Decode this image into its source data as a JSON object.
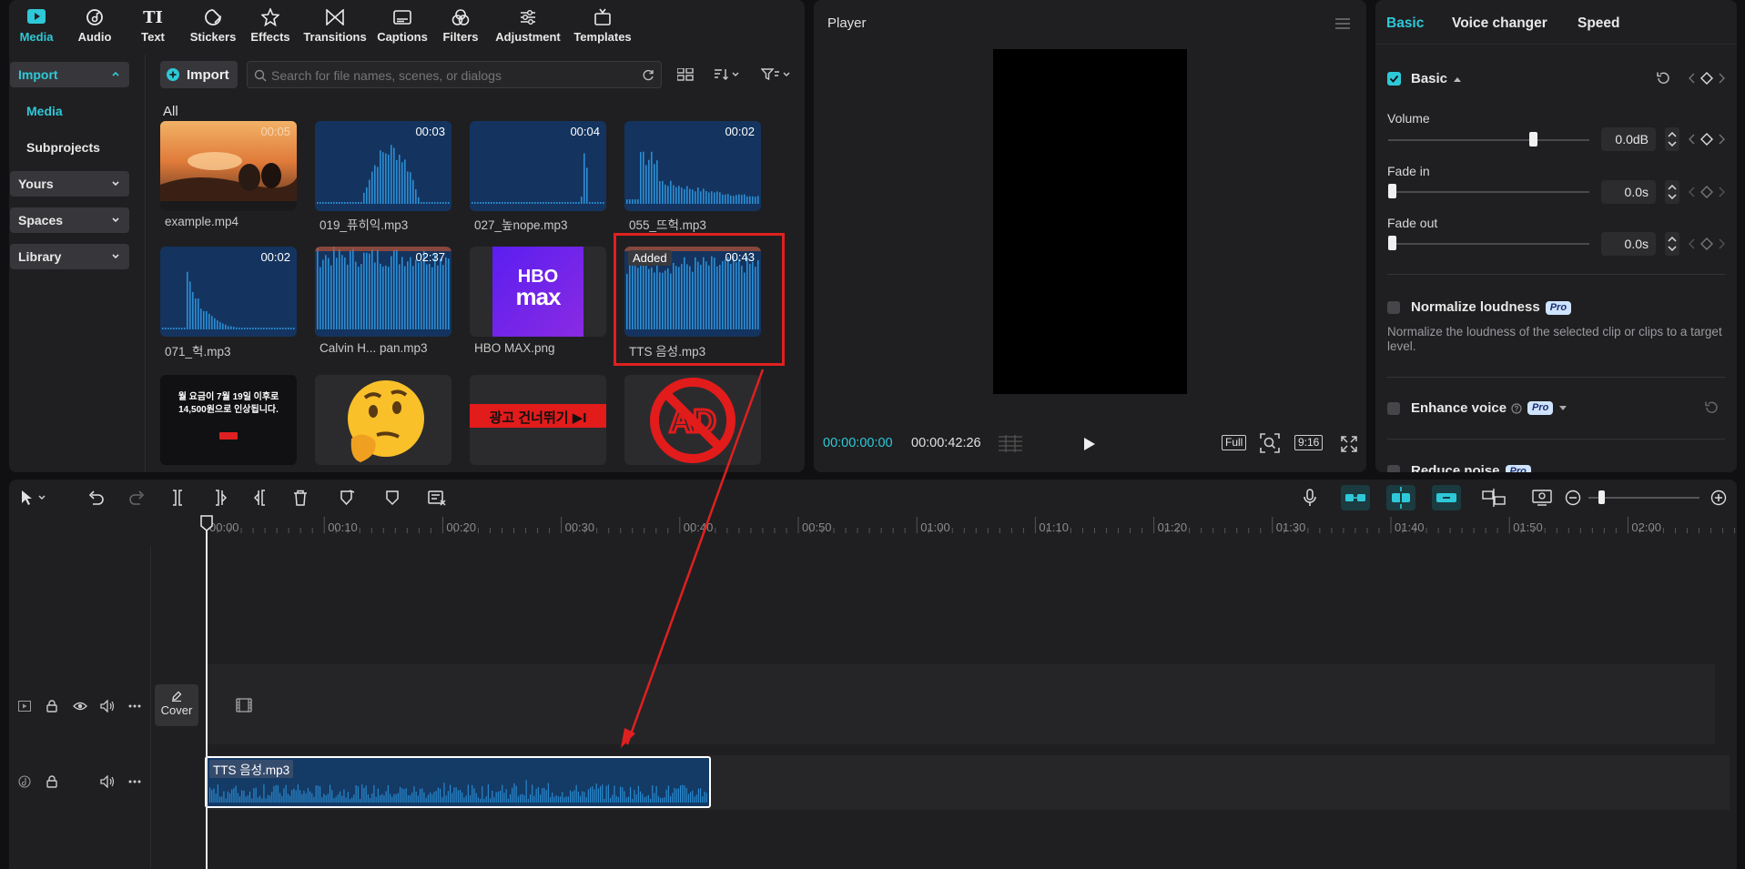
{
  "top_tabs": [
    {
      "label": "Media",
      "icon": "media-icon",
      "active": true
    },
    {
      "label": "Audio",
      "icon": "audio-icon"
    },
    {
      "label": "Text",
      "icon": "text-icon"
    },
    {
      "label": "Stickers",
      "icon": "stickers-icon"
    },
    {
      "label": "Effects",
      "icon": "effects-icon"
    },
    {
      "label": "Transitions",
      "icon": "transitions-icon"
    },
    {
      "label": "Captions",
      "icon": "captions-icon"
    },
    {
      "label": "Filters",
      "icon": "filters-icon"
    },
    {
      "label": "Adjustment",
      "icon": "adjustment-icon"
    },
    {
      "label": "Templates",
      "icon": "templates-icon"
    }
  ],
  "left_nav": {
    "import": "Import",
    "media": "Media",
    "subprojects": "Subprojects",
    "yours": "Yours",
    "spaces": "Spaces",
    "library": "Library"
  },
  "media_toolbar": {
    "import_button": "Import",
    "search_placeholder": "Search for file names, scenes, or dialogs",
    "filter_label": "All"
  },
  "media_items": [
    {
      "name": "example.mp4",
      "duration": "00:05",
      "kind": "video"
    },
    {
      "name": "019_퓨히익.mp3",
      "duration": "00:03",
      "kind": "audio"
    },
    {
      "name": "027_높nope.mp3",
      "duration": "00:04",
      "kind": "audio"
    },
    {
      "name": "055_뜨헉.mp3",
      "duration": "00:02",
      "kind": "audio"
    },
    {
      "name": "071_헉.mp3",
      "duration": "00:02",
      "kind": "audio"
    },
    {
      "name": "Calvin H... pan.mp3",
      "duration": "02:37",
      "kind": "audio"
    },
    {
      "name": "HBO MAX.png",
      "duration": "",
      "kind": "image"
    },
    {
      "name": "TTS 음성.mp3",
      "duration": "00:43",
      "kind": "audio",
      "badge": "Added"
    }
  ],
  "third_row_texts": {
    "notice_line1": "월 요금이 7월 19일 이후로",
    "notice_line2": "14,500원으로 인상됩니다.",
    "ad_skip": "광고 건너뛰기 ▶I",
    "hbo_line1": "HBO",
    "hbo_line2": "max"
  },
  "player": {
    "title": "Player",
    "current_time": "00:00:00:00",
    "total_time": "00:00:42:26",
    "full_label": "Full",
    "ratio_label": "9:16"
  },
  "right_tabs": [
    "Basic",
    "Voice changer",
    "Speed"
  ],
  "basic_section": {
    "header": "Basic",
    "volume_label": "Volume",
    "volume_value": "0.0dB",
    "volume_level": 0.72,
    "fadein_label": "Fade in",
    "fadein_value": "0.0s",
    "fadeout_label": "Fade out",
    "fadeout_value": "0.0s",
    "normalize_label": "Normalize loudness",
    "normalize_desc": "Normalize the loudness of the selected clip or clips to a target level.",
    "enhance_label": "Enhance voice",
    "reduce_label": "Reduce noise",
    "pro_badge": "Pro"
  },
  "timeline": {
    "ruler": [
      "00:00",
      "00:10",
      "00:20",
      "00:30",
      "00:40",
      "00:50",
      "01:00",
      "01:10",
      "01:20",
      "01:30",
      "01:40",
      "01:50",
      "02:00"
    ],
    "cover_label": "Cover",
    "audio_clip_name": "TTS 음성.mp3"
  },
  "colors": {
    "accent": "#2ec9d8",
    "highlight": "#e02020",
    "waveform": "#2a8fd6",
    "clip_bg": "#143a66"
  }
}
